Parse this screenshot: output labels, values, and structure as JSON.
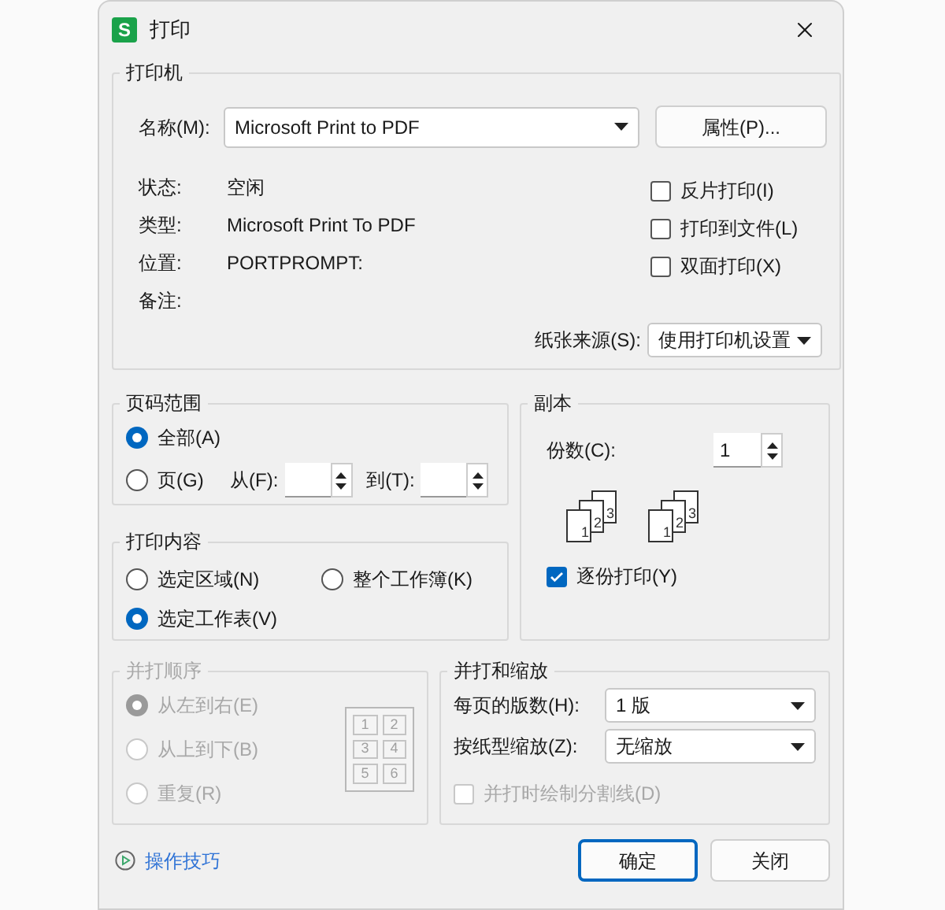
{
  "window": {
    "app_icon": "S",
    "title": "打印"
  },
  "printer": {
    "title": "打印机",
    "name_label": "名称(M):",
    "name_value": "Microsoft Print to PDF",
    "properties_button": "属性(P)...",
    "info": [
      {
        "label": "状态:",
        "value": "空闲"
      },
      {
        "label": "类型:",
        "value": "Microsoft Print To PDF"
      },
      {
        "label": "位置:",
        "value": "PORTPROMPT:"
      },
      {
        "label": "备注:"
      }
    ],
    "options": [
      {
        "label": "反片打印(I)",
        "checked": false
      },
      {
        "label": "打印到文件(L)",
        "checked": false
      },
      {
        "label": "双面打印(X)",
        "checked": false
      }
    ],
    "paper_source_label": "纸张来源(S):",
    "paper_source_value": "使用打印机设置"
  },
  "page_range": {
    "title": "页码范围",
    "options": [
      {
        "label": "全部(A)",
        "selected": true
      },
      {
        "label": "页(G)",
        "selected": false
      }
    ],
    "from_label": "从(F):",
    "to_label": "到(T):"
  },
  "print_content": {
    "title": "打印内容",
    "options": [
      {
        "label": "选定区域(N)",
        "selected": false
      },
      {
        "label": "整个工作簿(K)",
        "selected": false
      },
      {
        "label": "选定工作表(V)",
        "selected": true
      }
    ]
  },
  "copies": {
    "title": "副本",
    "count_label": "份数(C):",
    "count_value": "1",
    "collate_stacks": [
      [
        "1",
        "2",
        "3"
      ],
      [
        "1",
        "2",
        "3"
      ]
    ],
    "collate_label": "逐份打印(Y)",
    "collate": true
  },
  "combine_order": {
    "title": "并打顺序",
    "disabled": true,
    "options": [
      {
        "label": "从左到右(E)",
        "selected": true
      },
      {
        "label": "从上到下(B)",
        "selected": false
      },
      {
        "label": "重复(R)",
        "selected": false
      }
    ],
    "preview": [
      "1",
      "2",
      "3",
      "4",
      "5",
      "6"
    ]
  },
  "combine_scale": {
    "title": "并打和缩放",
    "pages_label": "每页的版数(H):",
    "pages_value": "1 版",
    "scale_label": "按纸型缩放(Z):",
    "scale_value": "无缩放",
    "divider_label": "并打时绘制分割线(D)",
    "divider_checked": false,
    "divider_disabled": true
  },
  "footer": {
    "tips_link": "操作技巧",
    "buttons": [
      {
        "label": "确定",
        "default": true
      },
      {
        "label": "关闭",
        "default": false
      }
    ]
  }
}
